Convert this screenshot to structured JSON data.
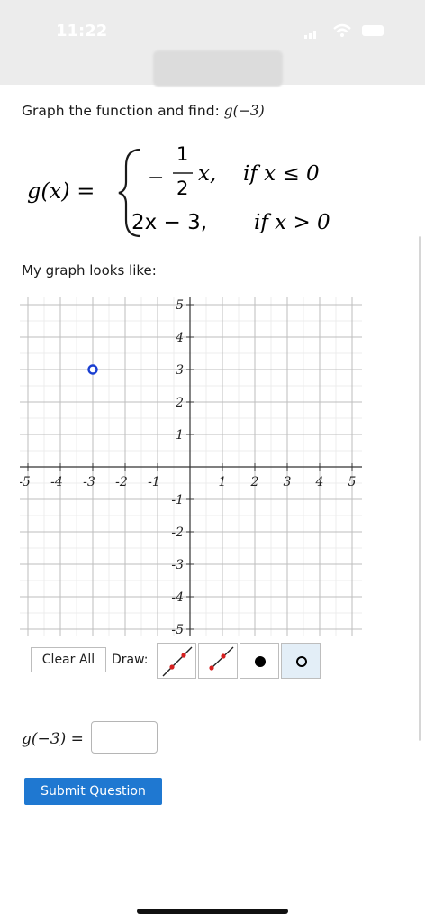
{
  "status_bar": {
    "time": "11:22"
  },
  "question": {
    "prefix": "Graph the function and find: ",
    "target": "g(−3)"
  },
  "formula": {
    "lhs": "g(x) =",
    "piece1_minus": "−",
    "piece1_num": "1",
    "piece1_den": "2",
    "piece1_var": "x,",
    "piece1_cond": "if x ≤ 0",
    "piece2_expr": "2x − 3,",
    "piece2_cond": "if x > 0"
  },
  "graph_caption": "My graph looks like:",
  "graph": {
    "x_ticks": [
      "-5",
      "-4",
      "-3",
      "-2",
      "-1",
      "1",
      "2",
      "3",
      "4",
      "5"
    ],
    "y_ticks_pos": [
      "5",
      "4",
      "3",
      "2",
      "1"
    ],
    "y_ticks_neg": [
      "-1",
      "-2",
      "-3",
      "-4",
      "-5"
    ],
    "open_point": {
      "x": -3,
      "y": 3
    },
    "point_color": "#1a3fd1"
  },
  "toolbar": {
    "clear_label": "Clear All",
    "draw_label": "Draw:",
    "tools": [
      "line-tool-icon",
      "segment-tool-icon",
      "closed-dot-icon",
      "open-dot-icon"
    ],
    "selected_tool": "open-dot-icon"
  },
  "answer": {
    "label": "g(−3) =",
    "value": ""
  },
  "submit_label": "Submit Question"
}
